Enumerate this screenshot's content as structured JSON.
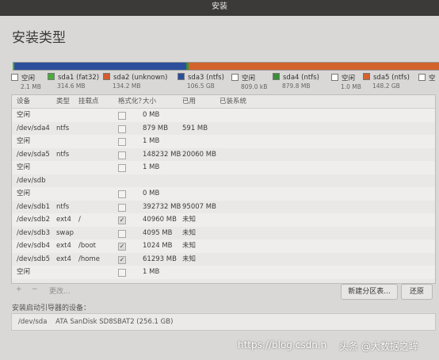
{
  "window": {
    "title": "安装"
  },
  "page": {
    "title": "安装类型"
  },
  "colors": {
    "free": "#ffffff",
    "fat32": "#4bab3c",
    "unknown": "#d35b2d",
    "ntfs": "#2c4f9c",
    "sda4": "#3a8f3a",
    "sda5": "#d2632d",
    "sdb": "#dcdcdc"
  },
  "legend": [
    {
      "label": "空闲",
      "sub": "2.1 MB",
      "color": "#ffffff"
    },
    {
      "label": "sda1 (fat32)",
      "sub": "314.6 MB",
      "color": "#4bab3c"
    },
    {
      "label": "sda2 (unknown)",
      "sub": "134.2 MB",
      "color": "#d35b2d"
    },
    {
      "label": "sda3 (ntfs)",
      "sub": "106.5 GB",
      "color": "#2c4f9c"
    },
    {
      "label": "空闲",
      "sub": "809.0 kB",
      "color": "#ffffff"
    },
    {
      "label": "sda4 (ntfs)",
      "sub": "879.8 MB",
      "color": "#3a8f3a"
    },
    {
      "label": "空闲",
      "sub": "1.0 MB",
      "color": "#ffffff"
    },
    {
      "label": "sda5 (ntfs)",
      "sub": "148.2 GB",
      "color": "#d2632d"
    },
    {
      "label": "空",
      "sub": "",
      "color": "#ffffff"
    }
  ],
  "bar_segments": [
    {
      "name": "sda1",
      "fraction": 0.003,
      "color": "#4bab3c"
    },
    {
      "name": "sda3",
      "fraction": 0.405,
      "color": "#2c4f9c"
    },
    {
      "name": "sda4",
      "fraction": 0.004,
      "color": "#3a8f3a"
    },
    {
      "name": "sda5",
      "fraction": 0.588,
      "color": "#d2632d"
    }
  ],
  "table": {
    "headers": {
      "device": "设备",
      "type": "类型",
      "mount": "挂载点",
      "format": "格式化？",
      "size": "大小",
      "used": "已用",
      "system": "已装系统"
    },
    "rows": [
      {
        "device": "空闲",
        "type": "",
        "mount": "",
        "format": false,
        "size": "0 MB",
        "used": ""
      },
      {
        "device": "/dev/sda4",
        "type": "ntfs",
        "mount": "",
        "format": false,
        "size": "879 MB",
        "used": "591 MB"
      },
      {
        "device": "空闲",
        "type": "",
        "mount": "",
        "format": false,
        "size": "1 MB",
        "used": ""
      },
      {
        "device": "/dev/sda5",
        "type": "ntfs",
        "mount": "",
        "format": false,
        "size": "148232 MB",
        "used": "20060 MB"
      },
      {
        "device": "空闲",
        "type": "",
        "mount": "",
        "format": false,
        "size": "1 MB",
        "used": ""
      },
      {
        "device": "/dev/sdb",
        "type": "",
        "mount": "",
        "format": null,
        "size": "",
        "used": ""
      },
      {
        "device": "空闲",
        "type": "",
        "mount": "",
        "format": false,
        "size": "0 MB",
        "used": ""
      },
      {
        "device": "/dev/sdb1",
        "type": "ntfs",
        "mount": "",
        "format": false,
        "size": "392732 MB",
        "used": "95007 MB"
      },
      {
        "device": "/dev/sdb2",
        "type": "ext4",
        "mount": "/",
        "format": true,
        "size": "40960 MB",
        "used": "未知"
      },
      {
        "device": "/dev/sdb3",
        "type": "swap",
        "mount": "",
        "format": false,
        "size": "4095 MB",
        "used": "未知"
      },
      {
        "device": "/dev/sdb4",
        "type": "ext4",
        "mount": "/boot",
        "format": true,
        "size": "1024 MB",
        "used": "未知"
      },
      {
        "device": "/dev/sdb5",
        "type": "ext4",
        "mount": "/home",
        "format": true,
        "size": "61293 MB",
        "used": "未知"
      },
      {
        "device": "空闲",
        "type": "",
        "mount": "",
        "format": false,
        "size": "1 MB",
        "used": ""
      }
    ]
  },
  "toolbar": {
    "add": "+",
    "remove": "−",
    "change": "更改...",
    "new_table": "新建分区表...",
    "revert": "还原"
  },
  "boot": {
    "label": "安装启动引导器的设备：",
    "device": "/dev/sda",
    "model": "ATA SanDisk SD8SBAT2 (256.1 GB)"
  },
  "watermark": {
    "url": "https://blog.csdn.n",
    "author": "头条 @大数据之眸"
  }
}
